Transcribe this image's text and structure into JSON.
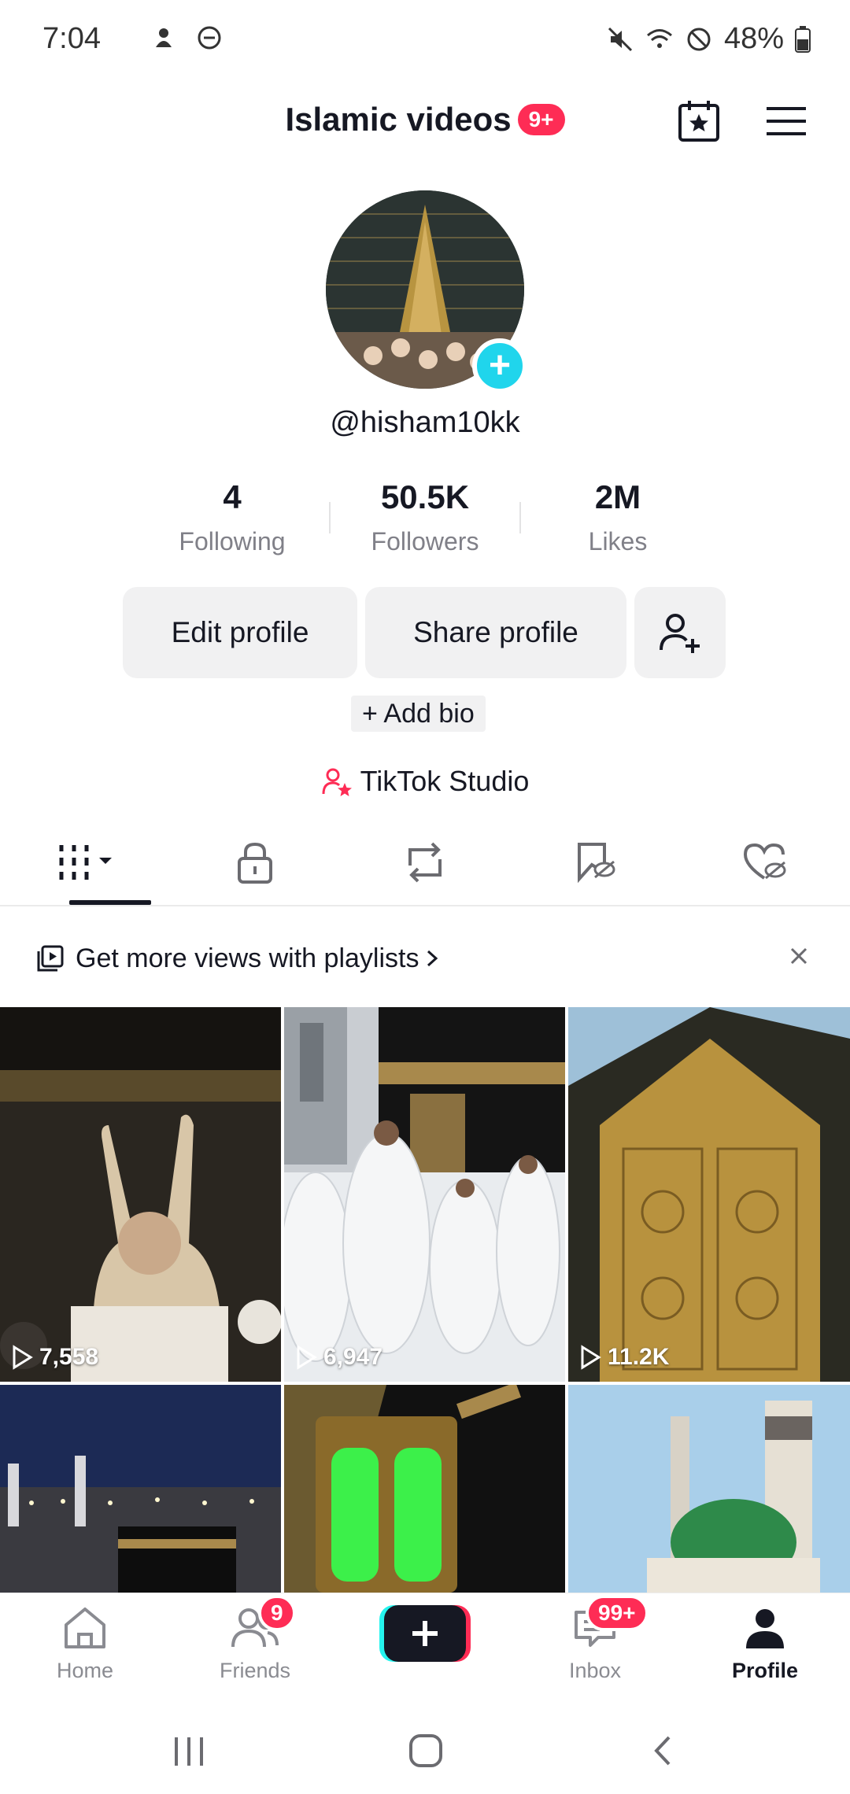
{
  "status_bar": {
    "time": "7:04",
    "battery": "48%"
  },
  "header": {
    "title": "Islamic videos",
    "badge": "9+"
  },
  "profile": {
    "username": "@hisham10kk",
    "stats": [
      {
        "value": "4",
        "label": "Following"
      },
      {
        "value": "50.5K",
        "label": "Followers"
      },
      {
        "value": "2M",
        "label": "Likes"
      }
    ],
    "edit_label": "Edit profile",
    "share_label": "Share profile",
    "add_bio": "+ Add bio",
    "studio_label": "TikTok Studio"
  },
  "banner": {
    "text": "Get more views with playlists"
  },
  "videos": [
    {
      "views": "7,558"
    },
    {
      "views": "6,947"
    },
    {
      "views": "11.2K"
    },
    {
      "views": ""
    },
    {
      "views": ""
    },
    {
      "views": ""
    }
  ],
  "bottom_nav": {
    "home": "Home",
    "friends": "Friends",
    "friends_badge": "9",
    "inbox": "Inbox",
    "inbox_badge": "99+",
    "profile": "Profile"
  },
  "colors": {
    "accent": "#fe2c55",
    "cyan": "#20d5ec",
    "text": "#161823",
    "muted": "#808088"
  }
}
